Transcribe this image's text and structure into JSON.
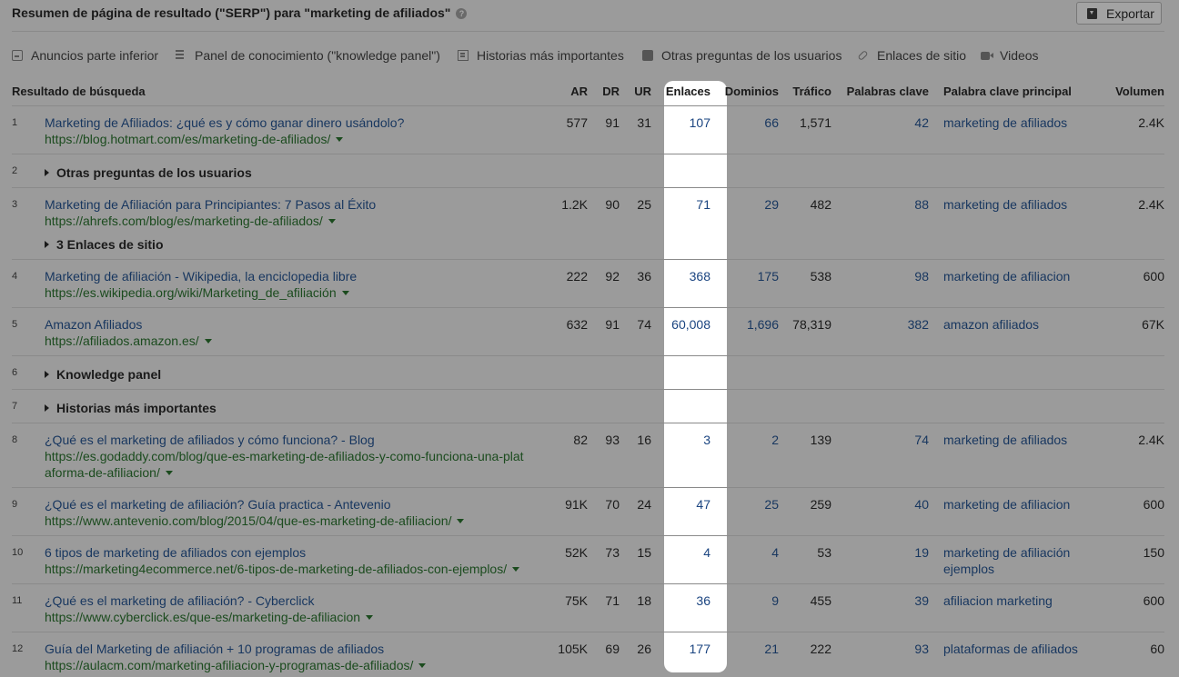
{
  "header": {
    "title": "Resumen de página de resultado (\"SERP\") para \"marketing de afiliados\"",
    "help_icon": "question-circle-icon",
    "export_label": "Exportar",
    "export_icon": "download-icon"
  },
  "features": [
    {
      "icon": "ad-icon",
      "label": "Anuncios parte inferior"
    },
    {
      "icon": "knowledge-panel-icon",
      "label": "Panel de conocimiento (\"knowledge panel\")"
    },
    {
      "icon": "news-icon",
      "label": "Historias más importantes"
    },
    {
      "icon": "question-icon",
      "label": "Otras preguntas de los usuarios"
    },
    {
      "icon": "link-icon",
      "label": "Enlaces de sitio"
    },
    {
      "icon": "video-icon",
      "label": "Videos"
    }
  ],
  "columns": {
    "result": "Resultado de búsqueda",
    "ar": "AR",
    "dr": "DR",
    "ur": "UR",
    "links": "Enlaces",
    "domains": "Dominios",
    "traffic": "Tráfico",
    "keywords": "Palabras clave",
    "top_keyword": "Palabra clave principal",
    "volume": "Volumen"
  },
  "rows": [
    {
      "n": "1",
      "title": "Marketing de Afiliados: ¿qué es y cómo ganar dinero usándolo?",
      "url": "https://blog.hotmart.com/es/marketing-de-afiliados/",
      "ar": "577",
      "dr": "91",
      "ur": "31",
      "links": "107",
      "domains": "66",
      "traffic": "1,571",
      "keywords": "42",
      "top_keyword": "marketing de afiliados",
      "volume": "2.4K"
    },
    {
      "n": "2",
      "group": "Otras preguntas de los usuarios"
    },
    {
      "n": "3",
      "title": "Marketing de Afiliación para Principiantes: 7 Pasos al Éxito",
      "url": "https://ahrefs.com/blog/es/marketing-de-afiliados/",
      "ar": "1.2K",
      "dr": "90",
      "ur": "25",
      "links": "71",
      "domains": "29",
      "traffic": "482",
      "keywords": "88",
      "top_keyword": "marketing de afiliados",
      "volume": "2.4K",
      "sitelinks": "3 Enlaces de sitio"
    },
    {
      "n": "4",
      "title": "Marketing de afiliación - Wikipedia, la enciclopedia libre",
      "url": "https://es.wikipedia.org/wiki/Marketing_de_afiliación",
      "ar": "222",
      "dr": "92",
      "ur": "36",
      "links": "368",
      "domains": "175",
      "traffic": "538",
      "keywords": "98",
      "top_keyword": "marketing de afiliacion",
      "volume": "600"
    },
    {
      "n": "5",
      "title": "Amazon Afiliados",
      "url": "https://afiliados.amazon.es/",
      "ar": "632",
      "dr": "91",
      "ur": "74",
      "links": "60,008",
      "domains": "1,696",
      "traffic": "78,319",
      "keywords": "382",
      "top_keyword": "amazon afiliados",
      "volume": "67K"
    },
    {
      "n": "6",
      "group": "Knowledge panel"
    },
    {
      "n": "7",
      "group": "Historias más importantes"
    },
    {
      "n": "8",
      "title": "¿Qué es el marketing de afiliados y cómo funciona? - Blog",
      "url_line1": "https://es.godaddy.com/blog/que-es-marketing-de-afiliados-y-como-funciona-una-plat",
      "url": "aforma-de-afiliacion/",
      "ar": "82",
      "dr": "93",
      "ur": "16",
      "links": "3",
      "domains": "2",
      "traffic": "139",
      "keywords": "74",
      "top_keyword": "marketing de afiliados",
      "volume": "2.4K"
    },
    {
      "n": "9",
      "title": "¿Qué es el marketing de afiliación? Guía practica - Antevenio",
      "url": "https://www.antevenio.com/blog/2015/04/que-es-marketing-de-afiliacion/",
      "ar": "91K",
      "dr": "70",
      "ur": "24",
      "links": "47",
      "domains": "25",
      "traffic": "259",
      "keywords": "40",
      "top_keyword": "marketing de afiliacion",
      "volume": "600"
    },
    {
      "n": "10",
      "title": "6 tipos de marketing de afiliados con ejemplos",
      "url": "https://marketing4ecommerce.net/6-tipos-de-marketing-de-afiliados-con-ejemplos/",
      "ar": "52K",
      "dr": "73",
      "ur": "15",
      "links": "4",
      "domains": "4",
      "traffic": "53",
      "keywords": "19",
      "top_keyword": "marketing de afiliación",
      "top_keyword_line2": "ejemplos",
      "volume": "150"
    },
    {
      "n": "11",
      "title": "¿Qué es el marketing de afiliación? - Cyberclick",
      "url": "https://www.cyberclick.es/que-es/marketing-de-afiliacion",
      "ar": "75K",
      "dr": "71",
      "ur": "18",
      "links": "36",
      "domains": "9",
      "traffic": "455",
      "keywords": "39",
      "top_keyword": "afiliacion marketing",
      "volume": "600"
    },
    {
      "n": "12",
      "title": "Guía del Marketing de afiliación + 10 programas de afiliados",
      "url": "https://aulacm.com/marketing-afiliacion-y-programas-de-afiliados/",
      "ar": "105K",
      "dr": "69",
      "ur": "26",
      "links": "177",
      "domains": "21",
      "traffic": "222",
      "keywords": "93",
      "top_keyword": "plataformas de afiliados",
      "volume": "60"
    }
  ]
}
